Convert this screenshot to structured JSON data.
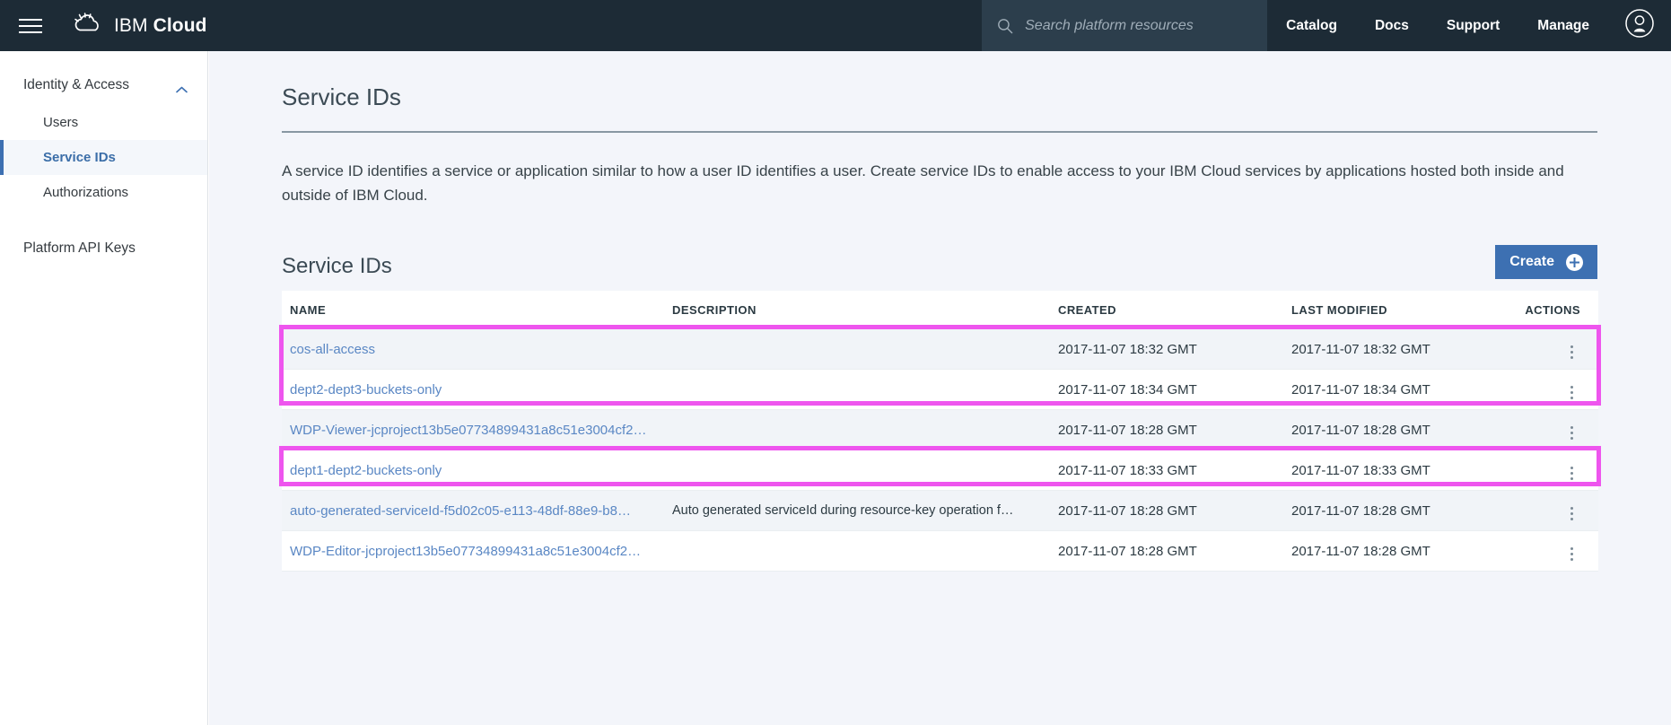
{
  "topnav": {
    "menu_icon": "hamburger-icon",
    "brand_logo_icon": "ibm-cloud-logo-icon",
    "brand_prefix": "IBM ",
    "brand_suffix": "Cloud",
    "search": {
      "icon": "search-icon",
      "placeholder": "Search platform resources",
      "value": ""
    },
    "links": [
      {
        "label": "Catalog"
      },
      {
        "label": "Docs"
      },
      {
        "label": "Support"
      },
      {
        "label": "Manage"
      }
    ],
    "avatar_icon": "user-avatar-icon",
    "background": "#1d2b36",
    "search_background": "#2c3e4c"
  },
  "sidebar": {
    "group": {
      "label": "Identity & Access",
      "expanded_icon": "chevron-up-icon",
      "items": [
        {
          "label": "Users",
          "active": false
        },
        {
          "label": "Service IDs",
          "active": true
        },
        {
          "label": "Authorizations",
          "active": false
        }
      ]
    },
    "top_items": [
      {
        "label": "Platform API Keys"
      }
    ],
    "active_color": "#3d70b2"
  },
  "main": {
    "page_title": "Service IDs",
    "description": "A service ID identifies a service or application similar to how a user ID identifies a user. Create service IDs to enable access to your IBM Cloud services by applications hosted both inside and outside of IBM Cloud.",
    "section_title": "Service IDs",
    "create_button": {
      "label": "Create",
      "icon": "plus-circle-icon",
      "color": "#3d70b2"
    },
    "table": {
      "columns": [
        "NAME",
        "DESCRIPTION",
        "CREATED",
        "LAST MODIFIED",
        "ACTIONS"
      ],
      "rows": [
        {
          "name": "cos-all-access",
          "description": "",
          "created": "2017-11-07 18:32 GMT",
          "last_modified": "2017-11-07 18:32 GMT",
          "actions_icon": "kebab-menu-icon"
        },
        {
          "name": "dept2-dept3-buckets-only",
          "description": "",
          "created": "2017-11-07 18:34 GMT",
          "last_modified": "2017-11-07 18:34 GMT",
          "actions_icon": "kebab-menu-icon"
        },
        {
          "name": "WDP-Viewer-jcproject13b5e07734899431a8c51e3004cf2…",
          "description": "",
          "created": "2017-11-07 18:28 GMT",
          "last_modified": "2017-11-07 18:28 GMT",
          "actions_icon": "kebab-menu-icon"
        },
        {
          "name": "dept1-dept2-buckets-only",
          "description": "",
          "created": "2017-11-07 18:33 GMT",
          "last_modified": "2017-11-07 18:33 GMT",
          "actions_icon": "kebab-menu-icon"
        },
        {
          "name": "auto-generated-serviceId-f5d02c05-e113-48df-88e9-b8…",
          "description": "Auto generated serviceId during resource-key operation f…",
          "created": "2017-11-07 18:28 GMT",
          "last_modified": "2017-11-07 18:28 GMT",
          "actions_icon": "kebab-menu-icon"
        },
        {
          "name": "WDP-Editor-jcproject13b5e07734899431a8c51e3004cf2…",
          "description": "",
          "created": "2017-11-07 18:28 GMT",
          "last_modified": "2017-11-07 18:28 GMT",
          "actions_icon": "kebab-menu-icon"
        }
      ]
    },
    "highlights": {
      "color": "#ee55ee",
      "boxes": [
        {
          "rows": [
            0,
            1
          ]
        },
        {
          "rows": [
            3
          ]
        }
      ]
    }
  }
}
